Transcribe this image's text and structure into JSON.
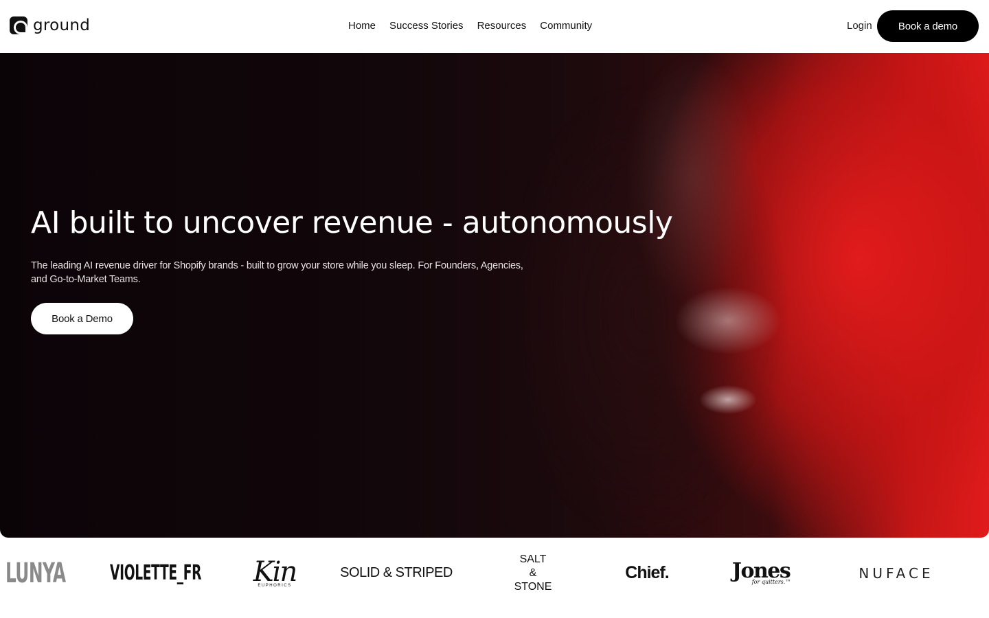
{
  "brand": {
    "name": "ground"
  },
  "nav": {
    "items": [
      {
        "label": "Home"
      },
      {
        "label": "Success Stories"
      },
      {
        "label": "Resources"
      },
      {
        "label": "Community"
      }
    ],
    "login": "Login",
    "cta": "Book a demo"
  },
  "hero": {
    "title": "AI built to uncover revenue - autonomously",
    "subtitle": "The leading AI revenue driver for Shopify brands - built to grow your store while you sleep. For Founders, Agencies, and Go-to-Market Teams.",
    "cta": "Book a Demo"
  },
  "customer_logos": [
    {
      "name": "LUNYA"
    },
    {
      "name": "VIOLETTE_FR"
    },
    {
      "name": "Kin",
      "tagline": "EUPHORICS"
    },
    {
      "name": "SOLID & STRIPED"
    },
    {
      "lines": [
        "SALT",
        "&",
        "STONE"
      ]
    },
    {
      "name": "Chief."
    },
    {
      "name": "Jones",
      "tagline": "for quitters.™"
    },
    {
      "name": "NUFACE"
    }
  ],
  "colors": {
    "header_bg": "#ffffff",
    "cta_bg": "#000000",
    "hero_accent": "#e11b1b",
    "hero_dark": "#0b0407"
  }
}
